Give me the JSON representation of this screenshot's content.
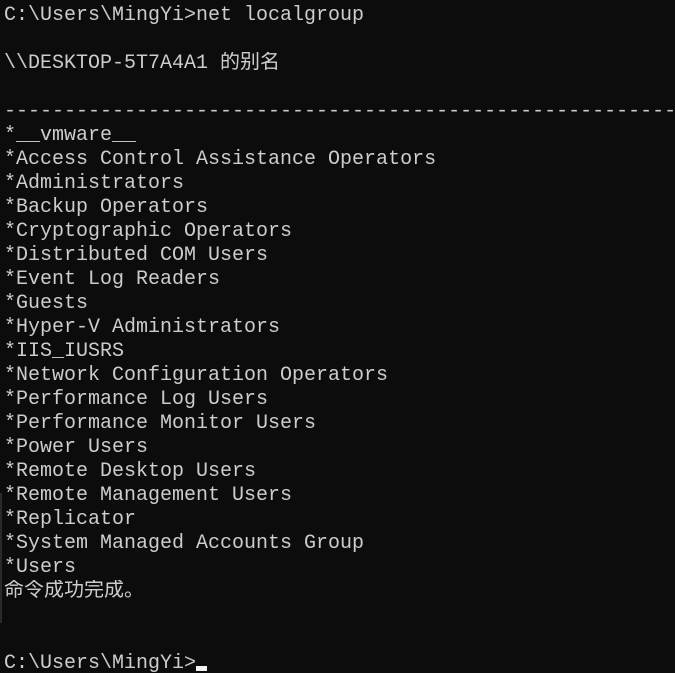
{
  "console": {
    "command_line": "C:\\Users\\MingYi>net localgroup",
    "alias_header": "\\\\DESKTOP-5T7A4A1 的别名",
    "separator": "-----------------------------------------------------------------------------------",
    "groups": [
      "*__vmware__",
      "*Access Control Assistance Operators",
      "*Administrators",
      "*Backup Operators",
      "*Cryptographic Operators",
      "*Distributed COM Users",
      "*Event Log Readers",
      "*Guests",
      "*Hyper-V Administrators",
      "*IIS_IUSRS",
      "*Network Configuration Operators",
      "*Performance Log Users",
      "*Performance Monitor Users",
      "*Power Users",
      "*Remote Desktop Users",
      "*Remote Management Users",
      "*Replicator",
      "*System Managed Accounts Group",
      "*Users"
    ],
    "success_message": "命令成功完成。",
    "prompt": "C:\\Users\\MingYi>"
  },
  "colors": {
    "background": "#0c0c0c",
    "text": "#cccccc",
    "cursor": "#f2f2f2"
  }
}
